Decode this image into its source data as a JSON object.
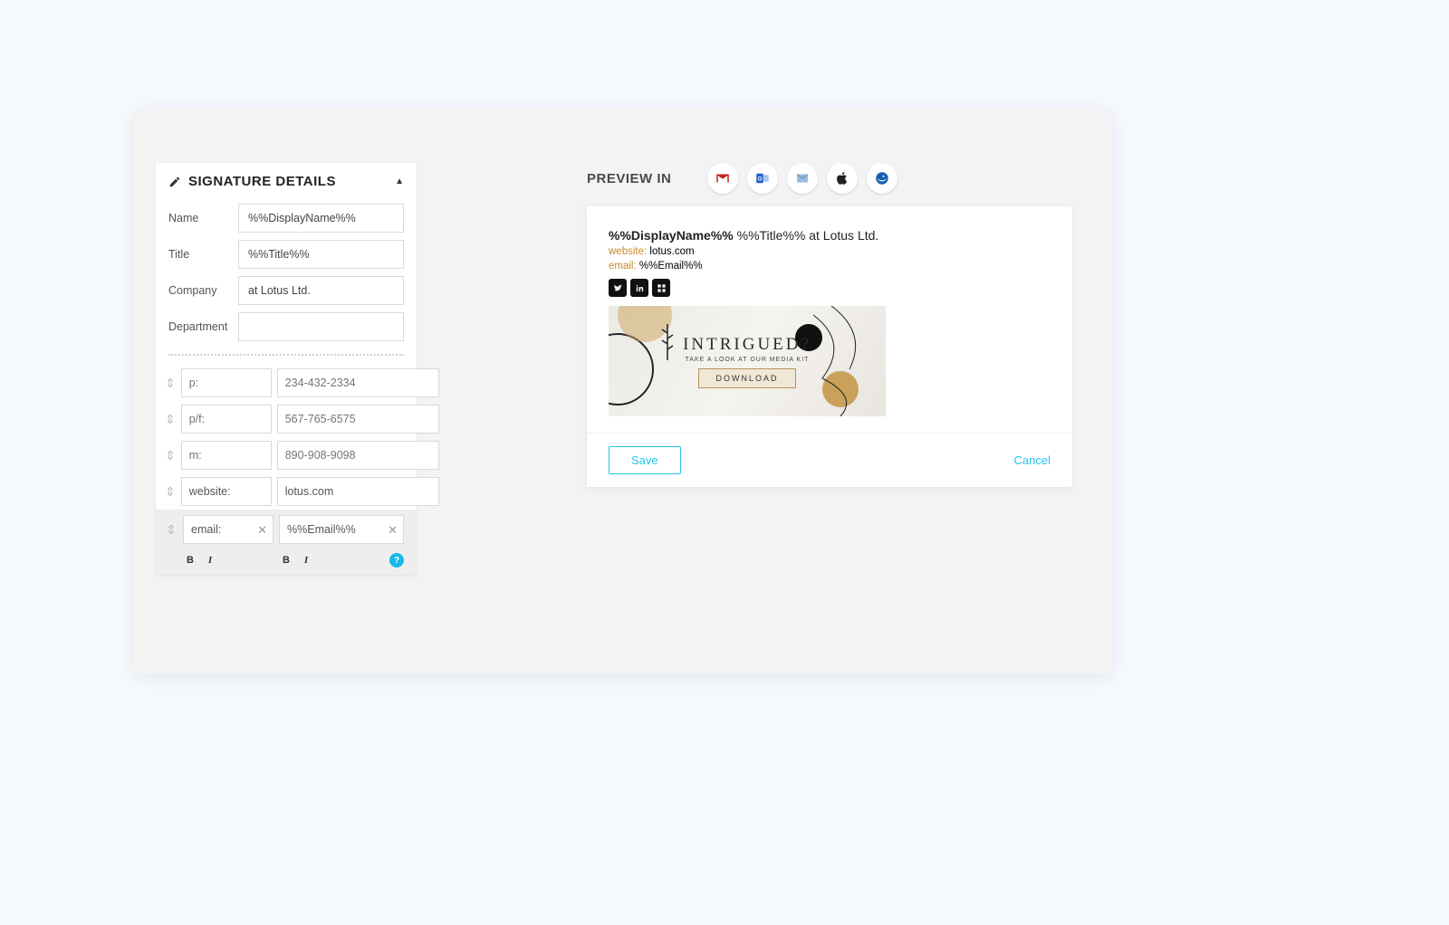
{
  "details": {
    "heading": "SIGNATURE DETAILS",
    "fields": {
      "name": {
        "label": "Name",
        "value": "%%DisplayName%%"
      },
      "title": {
        "label": "Title",
        "value": "%%Title%%"
      },
      "company": {
        "label": "Company",
        "value": "at Lotus Ltd."
      },
      "department": {
        "label": "Department",
        "value": ""
      }
    },
    "contacts": [
      {
        "label": "",
        "label_placeholder": "p:",
        "value": "",
        "value_placeholder": "234-432-2334"
      },
      {
        "label": "",
        "label_placeholder": "p/f:",
        "value": "",
        "value_placeholder": "567-765-6575"
      },
      {
        "label": "",
        "label_placeholder": "m:",
        "value": "",
        "value_placeholder": "890-908-9098"
      },
      {
        "label": "website:",
        "label_placeholder": "",
        "value": "lotus.com",
        "value_placeholder": ""
      },
      {
        "label": "email:",
        "label_placeholder": "",
        "value": "%%Email%%",
        "value_placeholder": "",
        "active": true
      }
    ],
    "help": "?"
  },
  "preview": {
    "header_label": "PREVIEW IN",
    "clients": [
      "gmail",
      "outlook",
      "apple-mail-daemon",
      "apple",
      "thunderbird"
    ],
    "signature": {
      "display_name": "%%DisplayName%%",
      "role_line": "%%Title%% at Lotus Ltd.",
      "website_key": "website:",
      "website_val": "lotus.com",
      "email_key": "email:",
      "email_val": "%%Email%%",
      "social": [
        "twitter",
        "linkedin",
        "other"
      ]
    },
    "banner": {
      "title": "INTRIGUED?",
      "subtitle": "TAKE A LOOK AT OUR MEDIA KIT",
      "cta": "DOWNLOAD"
    },
    "actions": {
      "save": "Save",
      "cancel": "Cancel"
    }
  },
  "colors": {
    "accent": "#28c4ec",
    "link_key": "#c98a2a"
  }
}
